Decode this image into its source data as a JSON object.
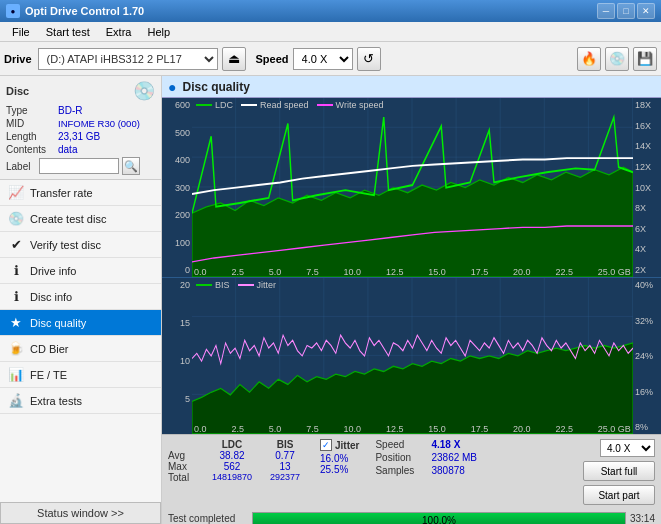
{
  "titlebar": {
    "icon": "●",
    "title": "Opti Drive Control 1.70",
    "min_btn": "─",
    "max_btn": "□",
    "close_btn": "✕"
  },
  "menubar": {
    "items": [
      "File",
      "Start test",
      "Extra",
      "Help"
    ]
  },
  "toolbar": {
    "drive_label": "Drive",
    "drive_value": "(D:) ATAPI iHBS312  2 PL17",
    "speed_label": "Speed",
    "speed_value": "4.0 X",
    "eject_icon": "⏏",
    "burn_icon": "🔥",
    "disc_icon": "💿",
    "save_icon": "💾"
  },
  "disc": {
    "header": "Disc",
    "type_label": "Type",
    "type_value": "BD-R",
    "mid_label": "MID",
    "mid_value": "INFOME R30 (000)",
    "length_label": "Length",
    "length_value": "23,31 GB",
    "contents_label": "Contents",
    "contents_value": "data",
    "label_label": "Label",
    "label_value": ""
  },
  "nav_items": [
    {
      "id": "transfer-rate",
      "label": "Transfer rate",
      "icon": "📈"
    },
    {
      "id": "create-test-disc",
      "label": "Create test disc",
      "icon": "💿"
    },
    {
      "id": "verify-test-disc",
      "label": "Verify test disc",
      "icon": "✔"
    },
    {
      "id": "drive-info",
      "label": "Drive info",
      "icon": "ℹ"
    },
    {
      "id": "disc-info",
      "label": "Disc info",
      "icon": "ℹ"
    },
    {
      "id": "disc-quality",
      "label": "Disc quality",
      "icon": "★",
      "active": true
    },
    {
      "id": "cd-bier",
      "label": "CD Bier",
      "icon": "🍺"
    },
    {
      "id": "fe-te",
      "label": "FE / TE",
      "icon": "📊"
    },
    {
      "id": "extra-tests",
      "label": "Extra tests",
      "icon": "🔬"
    }
  ],
  "status_window_btn": "Status window >>",
  "disc_quality": {
    "title": "Disc quality",
    "icon": "●",
    "legend_top": [
      {
        "label": "LDC",
        "color": "#00cc00"
      },
      {
        "label": "Read speed",
        "color": "#ffffff"
      },
      {
        "label": "Write speed",
        "color": "#ff44ff"
      }
    ],
    "legend_bottom": [
      {
        "label": "BIS",
        "color": "#00cc00"
      },
      {
        "label": "Jitter",
        "color": "#ff88ff"
      }
    ],
    "chart_top": {
      "y_left": [
        "600",
        "500",
        "400",
        "300",
        "200",
        "100",
        "0"
      ],
      "y_right": [
        "18X",
        "16X",
        "14X",
        "12X",
        "10X",
        "8X",
        "6X",
        "4X",
        "2X"
      ],
      "x_labels": [
        "0.0",
        "2.5",
        "5.0",
        "7.5",
        "10.0",
        "12.5",
        "15.0",
        "17.5",
        "20.0",
        "22.5",
        "25.0 GB"
      ]
    },
    "chart_bottom": {
      "y_left": [
        "20",
        "15",
        "10",
        "5"
      ],
      "y_right": [
        "40%",
        "32%",
        "24%",
        "16%",
        "8%"
      ],
      "x_labels": [
        "0.0",
        "2.5",
        "5.0",
        "7.5",
        "10.0",
        "12.5",
        "15.0",
        "17.5",
        "20.0",
        "22.5",
        "25.0 GB"
      ]
    }
  },
  "stats": {
    "headers": [
      "LDC",
      "BIS"
    ],
    "jitter_label": "Jitter",
    "jitter_checked": true,
    "rows": [
      {
        "label": "Avg",
        "ldc": "38.82",
        "bis": "0.77",
        "jitter": "16.0%"
      },
      {
        "label": "Max",
        "ldc": "562",
        "bis": "13",
        "jitter": "25.5%"
      },
      {
        "label": "Total",
        "ldc": "14819870",
        "bis": "292377",
        "jitter": ""
      }
    ],
    "speed_label": "Speed",
    "speed_value": "4.18 X",
    "speed_select": "4.0 X",
    "position_label": "Position",
    "position_value": "23862 MB",
    "samples_label": "Samples",
    "samples_value": "380878",
    "start_full_label": "Start full",
    "start_part_label": "Start part"
  },
  "progress": {
    "fill_percent": 100,
    "display_text": "100.0%",
    "status_text": "Test completed",
    "time_text": "33:14"
  }
}
